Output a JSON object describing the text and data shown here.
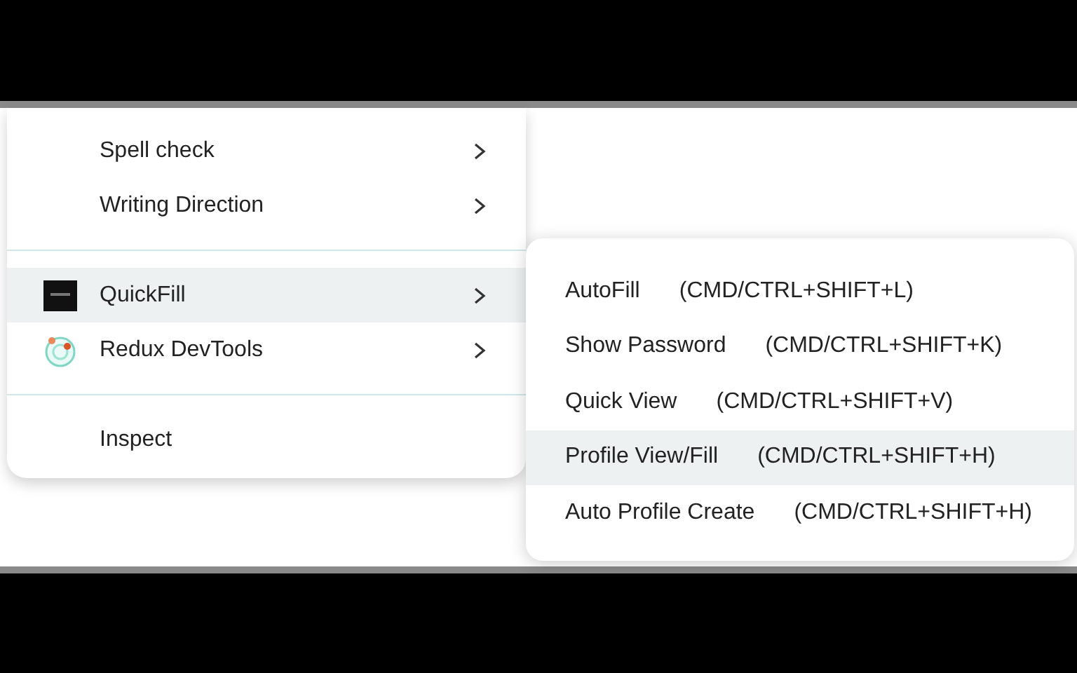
{
  "menu": {
    "items": [
      {
        "kind": "item",
        "label": "Spell check",
        "has_submenu": true,
        "selected": false
      },
      {
        "kind": "item",
        "label": "Writing Direction",
        "has_submenu": true,
        "selected": false
      },
      {
        "kind": "separator"
      },
      {
        "kind": "extension",
        "label": "QuickFill",
        "has_submenu": true,
        "selected": true
      },
      {
        "kind": "devtools",
        "label": "Redux DevTools",
        "has_submenu": true,
        "selected": false
      },
      {
        "kind": "separator"
      },
      {
        "kind": "item",
        "label": "Inspect",
        "has_submenu": false,
        "selected": false
      }
    ]
  },
  "submenu": {
    "items": [
      {
        "label": "AutoFill",
        "shortcut": "(CMD/CTRL+SHIFT+L)",
        "selected": false
      },
      {
        "label": "Show Password",
        "shortcut": "(CMD/CTRL+SHIFT+K)",
        "selected": false
      },
      {
        "label": "Quick View",
        "shortcut": "(CMD/CTRL+SHIFT+V)",
        "selected": false
      },
      {
        "label": "Profile View/Fill",
        "shortcut": "(CMD/CTRL+SHIFT+H)",
        "selected": true
      },
      {
        "label": "Auto Profile Create",
        "shortcut": "(CMD/CTRL+SHIFT+H)",
        "selected": false
      }
    ]
  }
}
